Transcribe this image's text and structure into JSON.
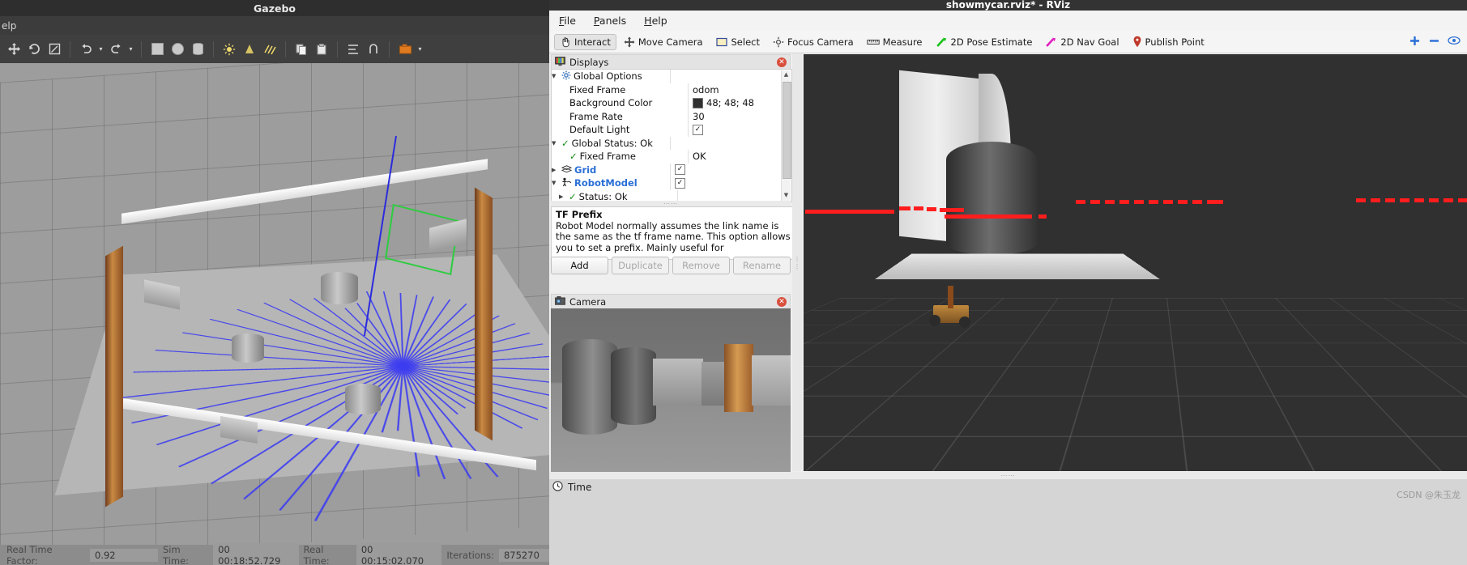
{
  "gazebo": {
    "title": "Gazebo",
    "menu_partial": "elp",
    "toolbar_icons": [
      "move-tool",
      "rotate-tool",
      "scale-tool",
      "undo",
      "undo-dropdown",
      "redo",
      "redo-dropdown",
      "box-primitive",
      "sphere-primitive",
      "cylinder-primitive",
      "point-light",
      "spot-light",
      "directional-light",
      "copy",
      "paste",
      "align",
      "snap",
      "screenshot",
      "log"
    ],
    "status": {
      "rtf_label": "Real Time Factor:",
      "rtf_value": "0.92",
      "sim_label": "Sim Time:",
      "sim_value": "00 00:18:52.729",
      "real_label": "Real Time:",
      "real_value": "00 00:15:02.070",
      "iter_label": "Iterations:",
      "iter_value": "875270"
    }
  },
  "rviz": {
    "title": "showmycar.rviz* - RViz",
    "menus": [
      "File",
      "Panels",
      "Help"
    ],
    "toolbar": [
      {
        "label": "Interact",
        "icon": "hand-icon",
        "active": true
      },
      {
        "label": "Move Camera",
        "icon": "move-camera-icon",
        "active": false
      },
      {
        "label": "Select",
        "icon": "select-rect-icon",
        "active": false
      },
      {
        "label": "Focus Camera",
        "icon": "focus-camera-icon",
        "active": false
      },
      {
        "label": "Measure",
        "icon": "ruler-icon",
        "active": false
      },
      {
        "label": "2D Pose Estimate",
        "icon": "green-arrow-icon",
        "active": false
      },
      {
        "label": "2D Nav Goal",
        "icon": "magenta-arrow-icon",
        "active": false
      },
      {
        "label": "Publish Point",
        "icon": "map-pin-icon",
        "active": false
      }
    ],
    "toolbar_right_icons": [
      "add-tool-icon",
      "remove-tool-icon",
      "help-tool-icon"
    ],
    "displays": {
      "panel_title": "Displays",
      "panel_icon": "displays-icon",
      "close_icon": "close-icon",
      "rows": [
        {
          "name": "Global Options",
          "value": "",
          "indent": 0,
          "arrow": "open",
          "icon": "gear-icon",
          "style": "plain"
        },
        {
          "name": "Fixed Frame",
          "value": "odom",
          "indent": 2,
          "arrow": "",
          "icon": "",
          "style": "plain",
          "valuetype": "text"
        },
        {
          "name": "Background Color",
          "value": "48; 48; 48",
          "indent": 2,
          "arrow": "",
          "icon": "",
          "style": "plain",
          "valuetype": "color",
          "color": "#303030"
        },
        {
          "name": "Frame Rate",
          "value": "30",
          "indent": 2,
          "arrow": "",
          "icon": "",
          "style": "plain",
          "valuetype": "text"
        },
        {
          "name": "Default Light",
          "value": "",
          "indent": 2,
          "arrow": "",
          "icon": "",
          "style": "plain",
          "valuetype": "checkbox",
          "checked": true
        },
        {
          "name": "Global Status: Ok",
          "value": "",
          "indent": 0,
          "arrow": "open",
          "icon": "check-icon",
          "style": "plain"
        },
        {
          "name": "Fixed Frame",
          "value": "OK",
          "indent": 2,
          "arrow": "",
          "icon": "check-icon",
          "style": "plain",
          "valuetype": "text"
        },
        {
          "name": "Grid",
          "value": "",
          "indent": 0,
          "arrow": "closed",
          "icon": "grid-icon",
          "style": "link",
          "valuetype": "checkbox",
          "checked": true
        },
        {
          "name": "RobotModel",
          "value": "",
          "indent": 0,
          "arrow": "open",
          "icon": "robot-icon",
          "style": "link",
          "valuetype": "checkbox",
          "checked": true
        },
        {
          "name": "Status: Ok",
          "value": "",
          "indent": 1,
          "arrow": "closed",
          "icon": "check-icon",
          "style": "plain"
        }
      ]
    },
    "description": {
      "title": "TF Prefix",
      "body": "Robot Model normally assumes the link name is the same as the tf frame name. This option allows you to set a prefix. Mainly useful for"
    },
    "buttons": [
      {
        "label": "Add",
        "enabled": true
      },
      {
        "label": "Duplicate",
        "enabled": false
      },
      {
        "label": "Remove",
        "enabled": false
      },
      {
        "label": "Rename",
        "enabled": false
      }
    ],
    "camera": {
      "panel_title": "Camera",
      "panel_icon": "camera-icon",
      "close_icon": "close-icon"
    },
    "time_panel": {
      "title": "Time",
      "icon": "clock-icon"
    },
    "watermark": "CSDN @朱玉龙"
  },
  "colors": {
    "accent_blue": "#2a6fd6",
    "status_green": "#1a8a1a",
    "close_red": "#d94f3d",
    "laser_blue": "#3d3df0",
    "scan_red": "#ff1d1d",
    "pose_green": "#2ecc40",
    "nav_magenta": "#e020c0",
    "rviz_bg": "#303030"
  }
}
